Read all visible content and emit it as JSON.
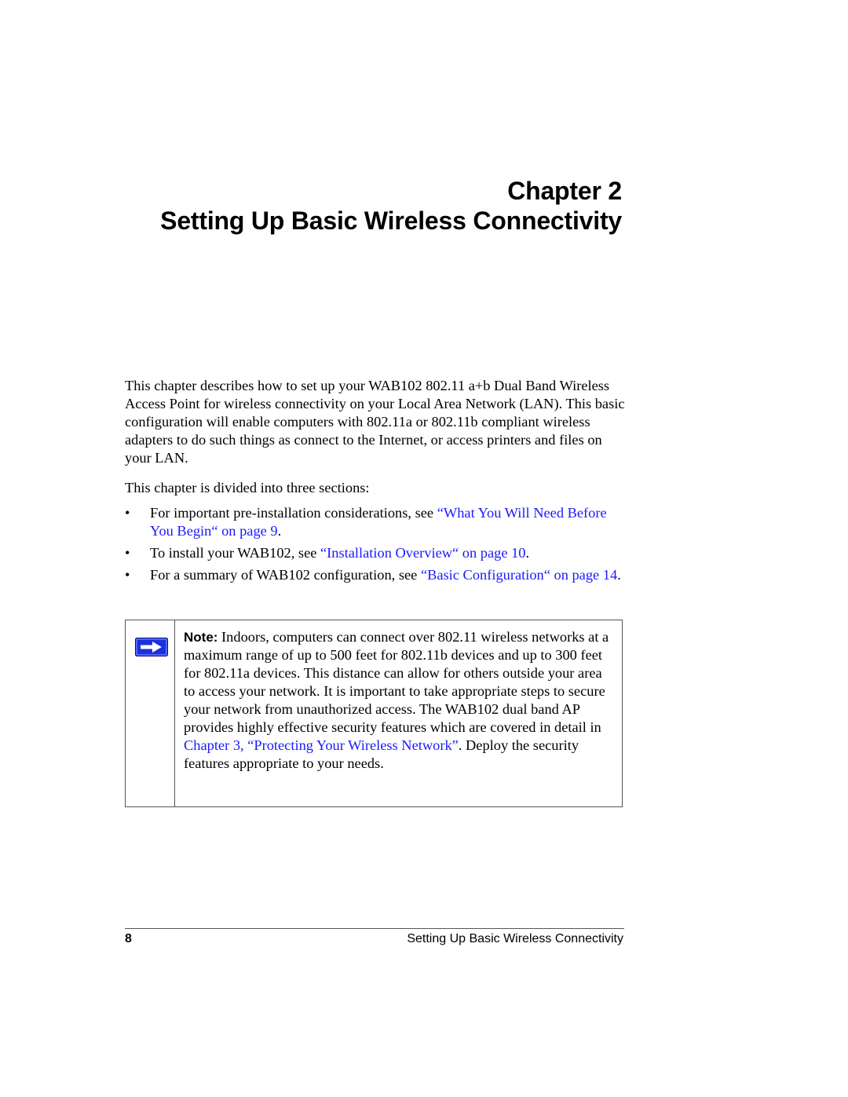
{
  "header": {
    "chapter_label": "Chapter 2",
    "chapter_title": "Setting Up Basic Wireless Connectivity"
  },
  "intro": {
    "paragraph": "This chapter describes how to set up your WAB102 802.11 a+b Dual Band Wireless Access Point for wireless connectivity on your Local Area Network (LAN). This basic configuration will enable computers with 802.11a or 802.11b compliant wireless adapters to do such things as connect to the Internet, or access printers and files on your LAN.",
    "sections_lead": "This chapter is divided into three sections:"
  },
  "bullets": [
    {
      "bullet": "•",
      "text_before": "For important pre-installation considerations, see ",
      "link_text": "“What You Will Need Before You Begin“ on page 9",
      "text_after": "."
    },
    {
      "bullet": "•",
      "text_before": "To install your WAB102, see ",
      "link_text": "“Installation Overview“ on page 10",
      "text_after": "."
    },
    {
      "bullet": "•",
      "text_before": "For a summary of WAB102 configuration, see ",
      "link_text": "“Basic Configuration“ on page 14",
      "text_after": "."
    }
  ],
  "note": {
    "icon": "right-arrow-icon",
    "label": "Note:",
    "text_before": " Indoors, computers can connect over 802.11 wireless networks at a maximum range of up to 500 feet for 802.11b devices and up to 300 feet for 802.11a devices. This distance can allow for others outside your area to access your network. It is important to take appropriate steps to secure your network from unauthorized access. The WAB102 dual band AP provides highly effective security features which are covered in detail in ",
    "link_text": "Chapter 3, “Protecting Your Wireless Network”",
    "text_after": ". Deploy the security features appropriate to your needs."
  },
  "footer": {
    "page_number": "8",
    "running_title": "Setting Up Basic Wireless Connectivity"
  },
  "colors": {
    "link": "#1a1aff",
    "icon_fill": "#1a2fe0"
  }
}
